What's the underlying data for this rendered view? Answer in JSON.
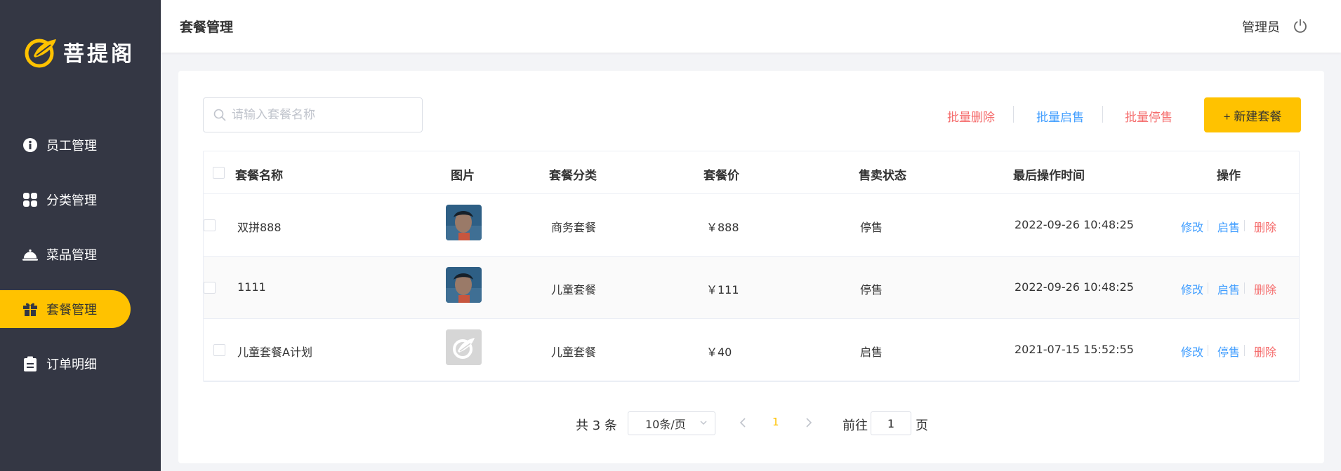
{
  "brand": {
    "name": "菩提阁",
    "accent": "#ffc200",
    "sidebar_bg": "#343744"
  },
  "sidebar": {
    "items": [
      {
        "label": "员工管理",
        "icon": "employee-icon",
        "active": false
      },
      {
        "label": "分类管理",
        "icon": "category-grid-icon",
        "active": false
      },
      {
        "label": "菜品管理",
        "icon": "dish-cloche-icon",
        "active": false
      },
      {
        "label": "套餐管理",
        "icon": "gift-icon",
        "active": true
      },
      {
        "label": "订单明细",
        "icon": "order-clipboard-icon",
        "active": false
      }
    ]
  },
  "header": {
    "title": "套餐管理",
    "user": "管理员",
    "logout_icon": "power-icon"
  },
  "toolbar": {
    "search_placeholder": "请输入套餐名称",
    "batch_delete": "批量删除",
    "batch_enable": "批量启售",
    "batch_disable": "批量停售",
    "new_button": "+ 新建套餐"
  },
  "table": {
    "columns": [
      "套餐名称",
      "图片",
      "套餐分类",
      "套餐价",
      "售卖状态",
      "最后操作时间",
      "操作"
    ],
    "rows": [
      {
        "name": "双拼888",
        "image": "photo",
        "category": "商务套餐",
        "price": "￥888",
        "status": "停售",
        "updated": "2022-09-26 10:48:25",
        "actions": [
          "修改",
          "启售",
          "删除"
        ]
      },
      {
        "name": "1111",
        "image": "photo",
        "category": "儿童套餐",
        "price": "￥111",
        "status": "停售",
        "updated": "2022-09-26 10:48:25",
        "actions": [
          "修改",
          "启售",
          "删除"
        ]
      },
      {
        "name": "儿童套餐A计划",
        "image": "placeholder-logo",
        "category": "儿童套餐",
        "price": "￥40",
        "status": "启售",
        "updated": "2021-07-15 15:52:55",
        "actions": [
          "修改",
          "停售",
          "删除"
        ]
      }
    ]
  },
  "pagination": {
    "total_text": "共 3 条",
    "page_size": "10条/页",
    "current_page": "1",
    "goto_prefix": "前往",
    "goto_value": "1",
    "goto_suffix": "页"
  }
}
